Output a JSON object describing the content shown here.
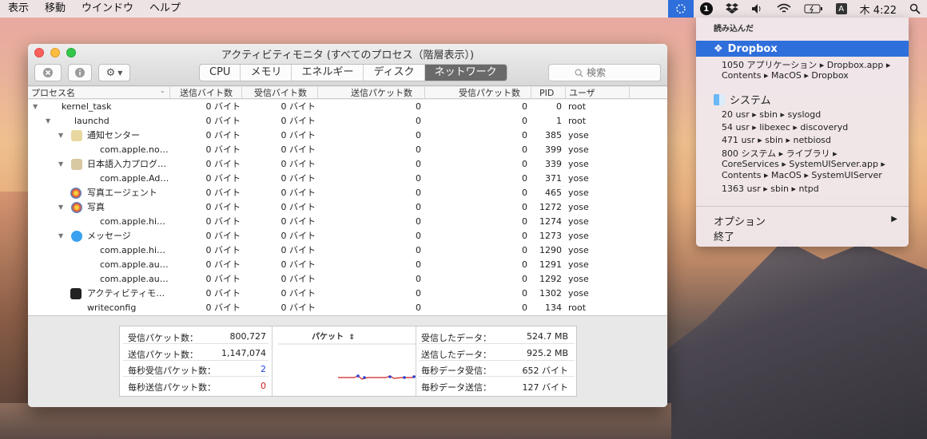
{
  "menubar": {
    "items": [
      "表示",
      "移動",
      "ウインドウ",
      "ヘルプ"
    ],
    "clock": "木 4:22",
    "input_method": "A",
    "password_app": "1"
  },
  "dropdown": {
    "header": "読み込んだ",
    "dropbox": {
      "title": "Dropbox",
      "lines": [
        "1050 アプリケーション ▸ Dropbox.app ▸",
        "Contents ▸ MacOS ▸ Dropbox"
      ]
    },
    "system": {
      "title": "システム",
      "lines": [
        "20 usr ▸ sbin ▸ syslogd",
        "54 usr ▸ libexec ▸ discoveryd",
        "471 usr ▸ sbin ▸ netbiosd",
        "800 システム ▸ ライブラリ ▸",
        "CoreServices ▸ SystemUIServer.app ▸",
        "Contents ▸ MacOS ▸ SystemUIServer",
        "1363 usr ▸ sbin ▸ ntpd"
      ]
    },
    "options": "オプション",
    "quit": "終了"
  },
  "window": {
    "title": "アクティビティモニタ (すべてのプロセス（階層表示）)",
    "tabs": [
      "CPU",
      "メモリ",
      "エネルギー",
      "ディスク",
      "ネットワーク"
    ],
    "active_tab": "ネットワーク",
    "search_placeholder": "検索"
  },
  "table": {
    "headers": {
      "name": "プロセス名",
      "sent_bytes": "送信バイト数",
      "recv_bytes": "受信バイト数",
      "sent_packets": "送信パケット数",
      "recv_packets": "受信パケット数",
      "pid": "PID",
      "user": "ユーザ"
    },
    "rows": [
      {
        "name": "kernel_task",
        "sent": "0 バイト",
        "recv": "0 バイト",
        "sp": "0",
        "rp": "0",
        "pid": "0",
        "user": "root"
      },
      {
        "name": "launchd",
        "sent": "0 バイト",
        "recv": "0 バイト",
        "sp": "0",
        "rp": "0",
        "pid": "1",
        "user": "root"
      },
      {
        "name": "通知センター",
        "sent": "0 バイト",
        "recv": "0 バイト",
        "sp": "0",
        "rp": "0",
        "pid": "385",
        "user": "yose"
      },
      {
        "name": "com.apple.no…",
        "sent": "0 バイト",
        "recv": "0 バイト",
        "sp": "0",
        "rp": "0",
        "pid": "399",
        "user": "yose"
      },
      {
        "name": "日本語入力プログ…",
        "sent": "0 バイト",
        "recv": "0 バイト",
        "sp": "0",
        "rp": "0",
        "pid": "339",
        "user": "yose"
      },
      {
        "name": "com.apple.Ad…",
        "sent": "0 バイト",
        "recv": "0 バイト",
        "sp": "0",
        "rp": "0",
        "pid": "371",
        "user": "yose"
      },
      {
        "name": "写真エージェント",
        "sent": "0 バイト",
        "recv": "0 バイト",
        "sp": "0",
        "rp": "0",
        "pid": "465",
        "user": "yose"
      },
      {
        "name": "写真",
        "sent": "0 バイト",
        "recv": "0 バイト",
        "sp": "0",
        "rp": "0",
        "pid": "1272",
        "user": "yose"
      },
      {
        "name": "com.apple.hi…",
        "sent": "0 バイト",
        "recv": "0 バイト",
        "sp": "0",
        "rp": "0",
        "pid": "1274",
        "user": "yose"
      },
      {
        "name": "メッセージ",
        "sent": "0 バイト",
        "recv": "0 バイト",
        "sp": "0",
        "rp": "0",
        "pid": "1273",
        "user": "yose"
      },
      {
        "name": "com.apple.hi…",
        "sent": "0 バイト",
        "recv": "0 バイト",
        "sp": "0",
        "rp": "0",
        "pid": "1290",
        "user": "yose"
      },
      {
        "name": "com.apple.au…",
        "sent": "0 バイト",
        "recv": "0 バイト",
        "sp": "0",
        "rp": "0",
        "pid": "1291",
        "user": "yose"
      },
      {
        "name": "com.apple.au…",
        "sent": "0 バイト",
        "recv": "0 バイト",
        "sp": "0",
        "rp": "0",
        "pid": "1292",
        "user": "yose"
      },
      {
        "name": "アクティビティモ…",
        "sent": "0 バイト",
        "recv": "0 バイト",
        "sp": "0",
        "rp": "0",
        "pid": "1302",
        "user": "yose"
      },
      {
        "name": "writeconfig",
        "sent": "0 バイト",
        "recv": "0 バイト",
        "sp": "0",
        "rp": "0",
        "pid": "134",
        "user": "root"
      }
    ]
  },
  "stats": {
    "recv_packets_label": "受信パケット数：",
    "recv_packets": "800,727",
    "sent_packets_label": "送信パケット数：",
    "sent_packets": "1,147,074",
    "recv_pps_label": "毎秒受信パケット数：",
    "recv_pps": "2",
    "sent_pps_label": "毎秒送信パケット数：",
    "sent_pps": "0",
    "graph_label": "パケット",
    "data_recv_label": "受信したデータ：",
    "data_recv": "524.7 MB",
    "data_sent_label": "送信したデータ：",
    "data_sent": "925.2 MB",
    "recv_rate_label": "毎秒データ受信：",
    "recv_rate": "652 バイト",
    "sent_rate_label": "毎秒データ送信：",
    "sent_rate": "127 バイト",
    "colors": {
      "recv": "#2740d0",
      "sent": "#d02020"
    }
  }
}
